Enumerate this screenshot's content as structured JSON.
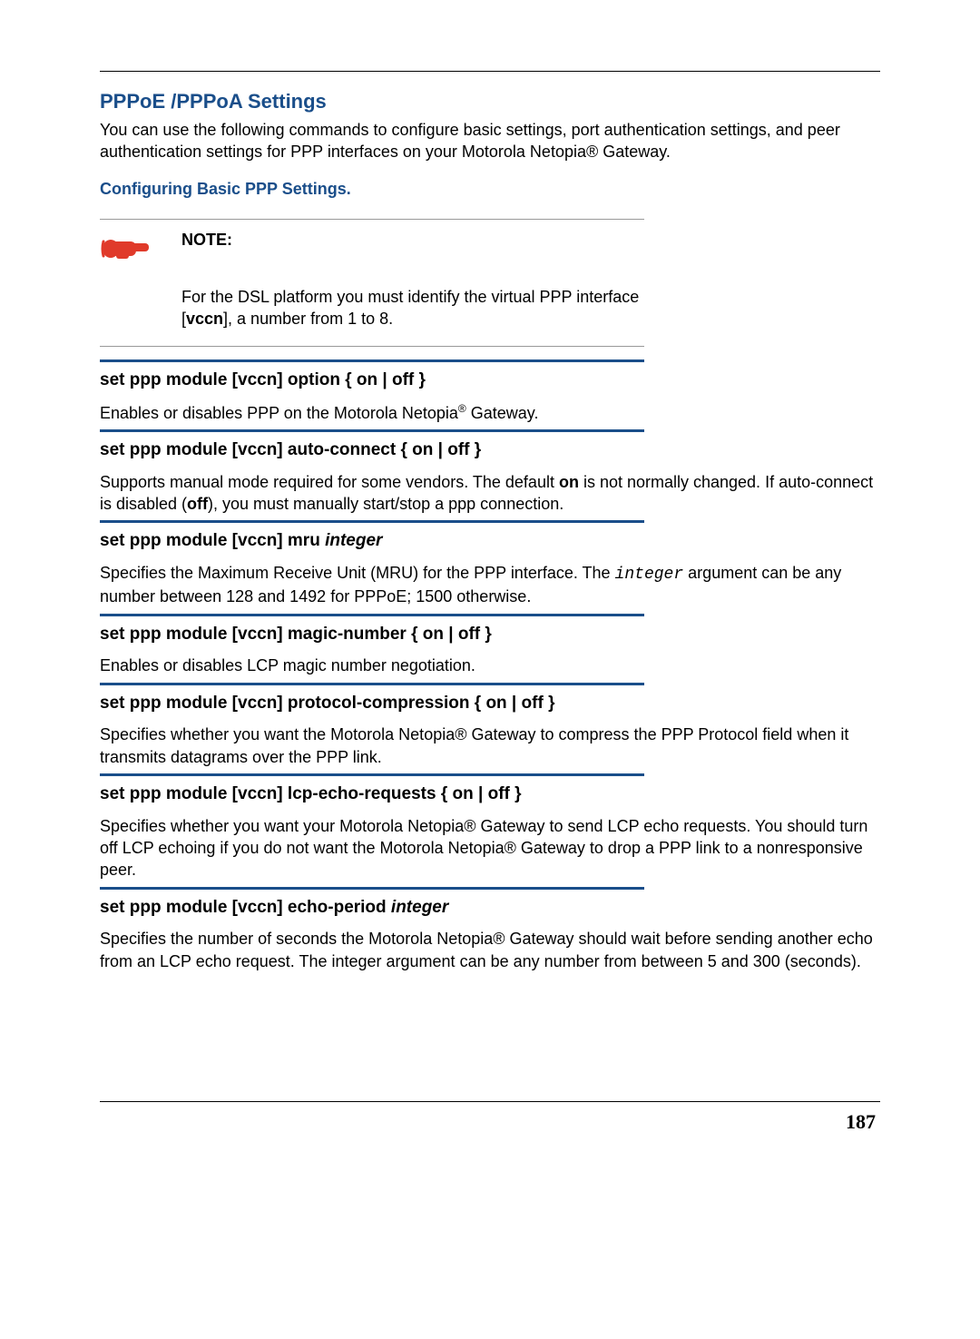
{
  "header": {
    "title": "PPPoE /PPPoA Settings",
    "intro": "You can use the following commands to configure basic settings, port authentication settings, and peer authentication settings for PPP interfaces on your Motorola Netopia® Gateway.",
    "subhead": "Configuring Basic PPP Settings."
  },
  "note": {
    "label": "NOTE:",
    "text_before": "For the DSL platform you must identify the virtual PPP interface [",
    "bold": "vccn",
    "text_after": "], a number from 1 to 8."
  },
  "commands": [
    {
      "head": "set ppp module [vccn] option { on | off }",
      "desc_before": "Enables or disables PPP on the Motorola Netopia",
      "desc_sup": "®",
      "desc_after": " Gateway."
    },
    {
      "head": "set ppp module [vccn] auto-connect { on | off }",
      "desc_parts": [
        {
          "t": "Supports manual mode required for some vendors. The default "
        },
        {
          "t": "on",
          "b": true
        },
        {
          "t": " is not normally changed. If auto-connect is disabled ("
        },
        {
          "t": "off",
          "b": true
        },
        {
          "t": "), you must manually start/stop a ppp connection."
        }
      ]
    },
    {
      "head_before": "set ppp module [vccn] mru ",
      "head_ital": "integer",
      "desc_parts": [
        {
          "t": "Specifies the Maximum Receive Unit (MRU) for the PPP interface. The "
        },
        {
          "t": "integer",
          "mono": true
        },
        {
          "t": " argument can be any number between 128 and 1492 for PPPoE; 1500 otherwise."
        }
      ]
    },
    {
      "head": "set ppp module [vccn] magic-number { on | off }",
      "desc": "Enables or disables LCP magic number negotiation."
    },
    {
      "head": "set ppp module [vccn] protocol-compression { on | off }",
      "desc": "Specifies whether you want the Motorola Netopia® Gateway to compress the PPP Protocol field when it transmits datagrams over the PPP link."
    },
    {
      "head": "set ppp module [vccn] lcp-echo-requests { on | off }",
      "desc": "Specifies whether you want your Motorola Netopia® Gateway to send LCP echo requests. You should turn off LCP echoing if you do not want the Motorola Netopia® Gateway to drop a PPP link to a nonresponsive peer."
    },
    {
      "head_before": "set ppp module [vccn] echo-period ",
      "head_ital": "integer",
      "desc": "Specifies the number of seconds the Motorola Netopia® Gateway should wait before sending another echo from an LCP echo request. The integer argument can be any number from between 5 and 300 (seconds)."
    }
  ],
  "page_number": "187"
}
